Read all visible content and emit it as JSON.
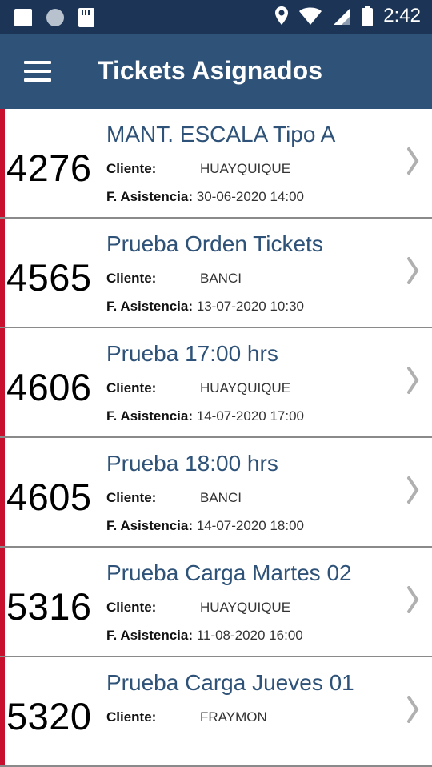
{
  "status_bar": {
    "time": "2:42"
  },
  "app_bar": {
    "title": "Tickets Asignados"
  },
  "labels": {
    "cliente": "Cliente:",
    "fecha": "F. Asistencia:"
  },
  "colors": {
    "app_bar": "#2e5278",
    "status_bar": "#1c3556",
    "accent_bar": "#c8102e",
    "title_text": "#2e5278"
  },
  "tickets": [
    {
      "number": "4276",
      "title": "MANT. ESCALA Tipo A",
      "client": "HUAYQUIQUE",
      "date": "30-06-2020 14:00"
    },
    {
      "number": "4565",
      "title": "Prueba Orden Tickets",
      "client": "BANCI",
      "date": "13-07-2020 10:30"
    },
    {
      "number": "4606",
      "title": "Prueba 17:00 hrs",
      "client": "HUAYQUIQUE",
      "date": "14-07-2020 17:00"
    },
    {
      "number": "4605",
      "title": "Prueba 18:00 hrs",
      "client": "BANCI",
      "date": "14-07-2020 18:00"
    },
    {
      "number": "5316",
      "title": "Prueba Carga Martes 02",
      "client": "HUAYQUIQUE",
      "date": "11-08-2020 16:00"
    },
    {
      "number": "5320",
      "title": "Prueba Carga Jueves 01",
      "client": "FRAYMON",
      "date": ""
    }
  ]
}
